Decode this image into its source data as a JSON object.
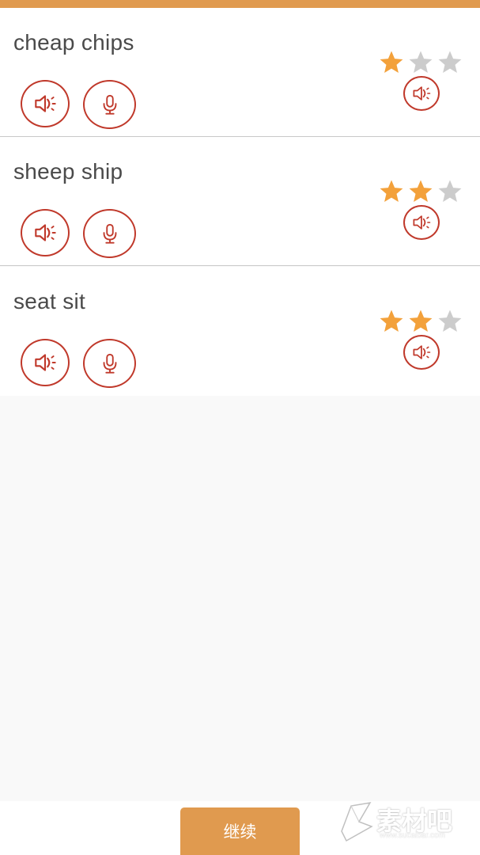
{
  "colors": {
    "accent": "#e09a4f",
    "icon_red": "#c0392b",
    "star_filled": "#f3a13b",
    "star_empty": "#cccccc",
    "background": "#f9f9f9"
  },
  "items": [
    {
      "phrase": "cheap chips",
      "stars": 1,
      "max_stars": 3,
      "play_icon": "speaker-icon",
      "mic_icon": "microphone-icon",
      "recording_icon": "speaker-icon"
    },
    {
      "phrase": "sheep ship",
      "stars": 2,
      "max_stars": 3,
      "play_icon": "speaker-icon",
      "mic_icon": "microphone-icon",
      "recording_icon": "speaker-icon"
    },
    {
      "phrase": "seat sit",
      "stars": 2,
      "max_stars": 3,
      "play_icon": "speaker-icon",
      "mic_icon": "microphone-icon",
      "recording_icon": "speaker-icon"
    }
  ],
  "footer": {
    "continue_label": "继续"
  },
  "watermark": {
    "text": "素材吧",
    "url": "www.sucaibar.com"
  }
}
